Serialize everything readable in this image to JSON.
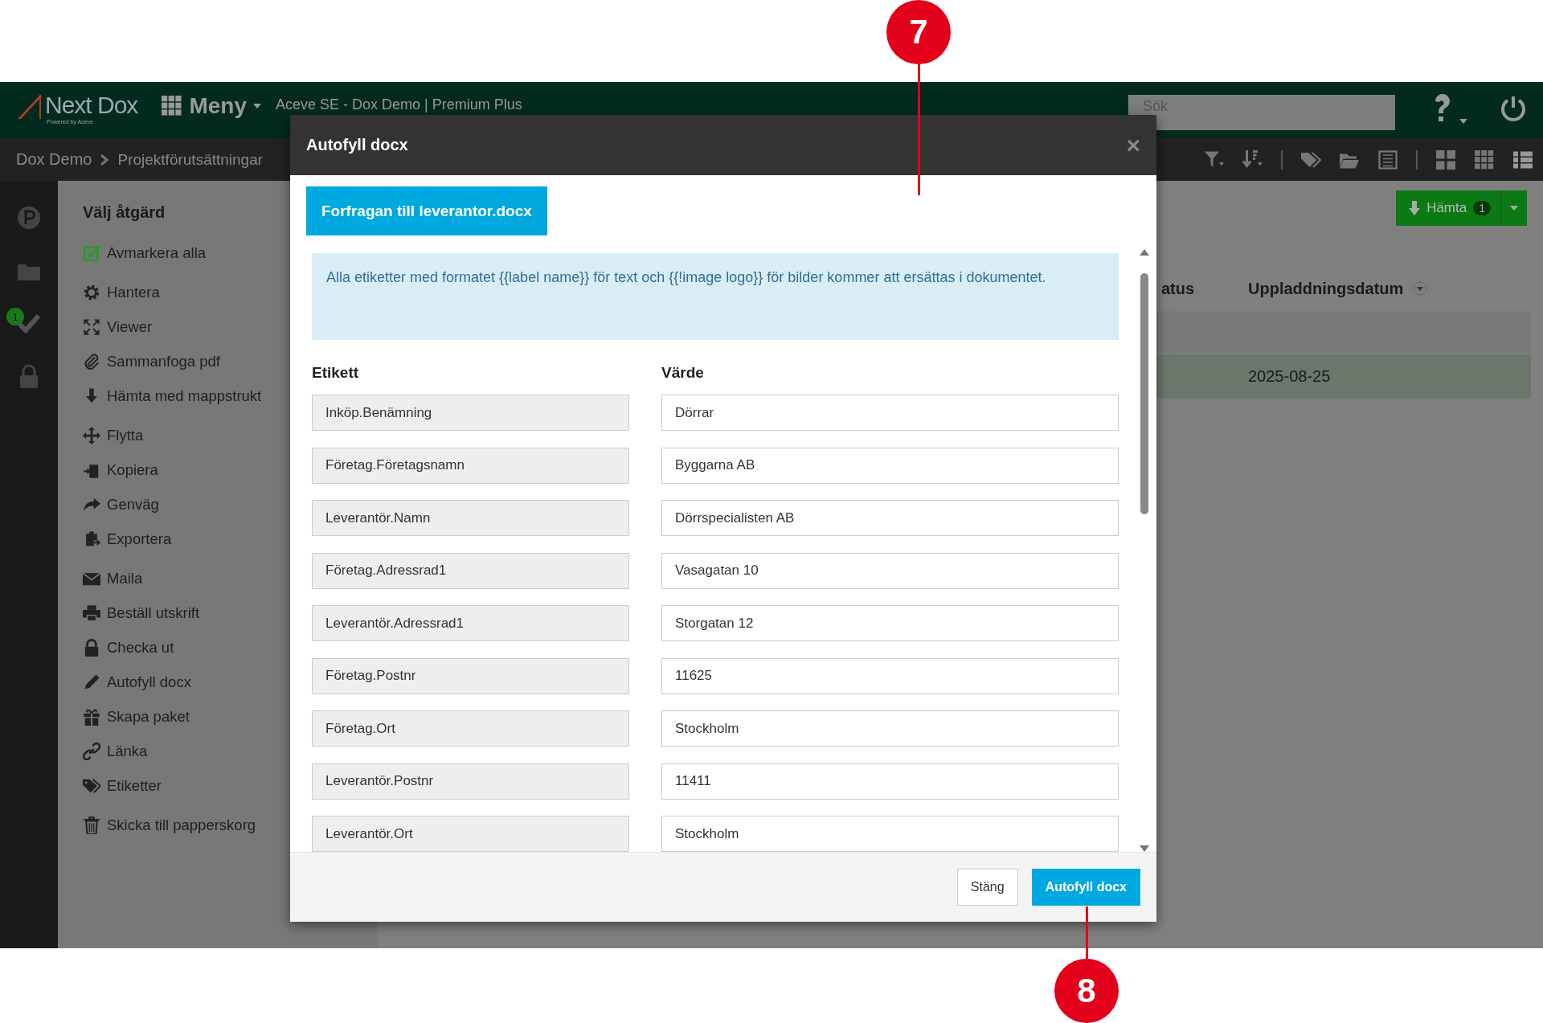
{
  "top_bar": {
    "logo": "Next Dox",
    "logo_tagline": "Powered by Aceve",
    "menu": "Meny",
    "account": "Aceve SE - Dox Demo | Premium Plus",
    "search": {
      "placeholder": "Sök"
    }
  },
  "breadcrumb": [
    "Dox Demo",
    "Projektförutsättningar"
  ],
  "rail": {
    "badge": "1"
  },
  "download_button": {
    "label": "Hämta",
    "count": "1"
  },
  "actions": {
    "title": "Välj åtgärd",
    "groups": [
      [
        "Avmarkera alla"
      ],
      [
        "Hantera",
        "Viewer",
        "Sammanfoga pdf",
        "Hämta med mappstrukt"
      ],
      [
        "Flytta",
        "Kopiera",
        "Genväg",
        "Exportera"
      ],
      [
        "Maila",
        "Beställ utskrift",
        "Checka ut",
        "Autofyll docx",
        "Skapa paket",
        "Länka",
        "Etiketter"
      ],
      [
        "Skicka till papperskorg"
      ]
    ]
  },
  "table": {
    "columns": [
      "atus",
      "Uppladdningsdatum"
    ],
    "rows": [
      {
        "selected": false
      },
      {
        "selected": true,
        "upload_date": "2025-08-25"
      }
    ]
  },
  "dialog": {
    "title": "Autofyll docx",
    "close": "×",
    "file": "Forfragan till leverantor.docx",
    "info": "Alla etiketter med formatet {{label name}} för text och {{!image logo}} för bilder kommer att ersättas i dokumentet.",
    "columns": [
      "Etikett",
      "Värde"
    ],
    "fields": [
      {
        "label": "Inköp.Benämning",
        "value": "Dörrar"
      },
      {
        "label": "Företag.Företagsnamn",
        "value": "Byggarna AB"
      },
      {
        "label": "Leverantör.Namn",
        "value": "Dörrspecialisten AB"
      },
      {
        "label": "Företag.Adressrad1",
        "value": "Vasagatan 10"
      },
      {
        "label": "Leverantör.Adressrad1",
        "value": "Storgatan 12"
      },
      {
        "label": "Företag.Postnr",
        "value": "11625"
      },
      {
        "label": "Företag.Ort",
        "value": "Stockholm"
      },
      {
        "label": "Leverantör.Postnr",
        "value": "11411"
      },
      {
        "label": "Leverantör.Ort",
        "value": "Stockholm"
      }
    ],
    "buttons": [
      {
        "label": "Stäng",
        "kind": "secondary"
      },
      {
        "label": "Autofyll docx",
        "kind": "primary"
      }
    ]
  },
  "callouts": [
    "7",
    "8"
  ]
}
